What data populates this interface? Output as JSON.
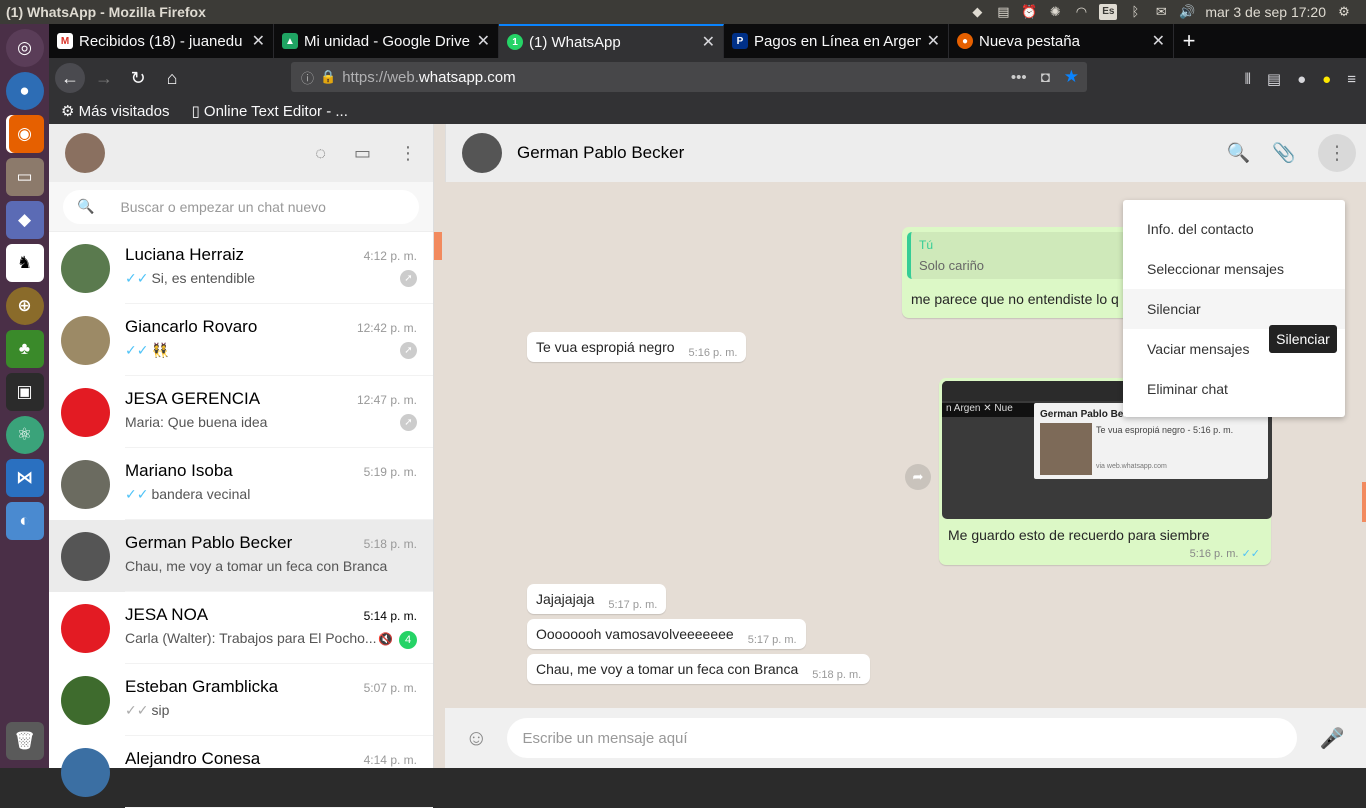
{
  "window": {
    "title": "(1) WhatsApp - Mozilla Firefox"
  },
  "tray": {
    "lang": "Es",
    "clock": "mar  3 de sep 17:20"
  },
  "tabs": [
    {
      "label": "Recibidos (18) - juanedu",
      "icon": "gmail-icon"
    },
    {
      "label": "Mi unidad - Google Drive",
      "icon": "drive-icon"
    },
    {
      "label": "(1) WhatsApp",
      "icon": "whatsapp-icon",
      "active": true
    },
    {
      "label": "Pagos en Línea en Argen",
      "icon": "paypal-icon"
    },
    {
      "label": "Nueva pestaña",
      "icon": "firefox-icon"
    }
  ],
  "url": {
    "prefix": "https://web.",
    "domain": "whatsapp.com"
  },
  "bookmarks": [
    "Más visitados",
    "Online Text Editor - ..."
  ],
  "sidebar": {
    "search_placeholder": "Buscar o empezar un chat nuevo",
    "chats": [
      {
        "name": "Luciana Herraiz",
        "time": "4:12 p. m.",
        "msg": "Si, es entendible",
        "tick": "✓✓",
        "pinned": true,
        "avatar_color": "#5a7a4e"
      },
      {
        "name": "Giancarlo Rovaro",
        "time": "12:42 p. m.",
        "msg": "👯",
        "tick": "✓✓",
        "pinned": true,
        "avatar_color": "#9c8a66"
      },
      {
        "name": "JESA GERENCIA",
        "time": "12:47 p. m.",
        "msg": "Maria: Que buena idea",
        "tick": "",
        "pinned": true,
        "avatar_color": "#e31b23"
      },
      {
        "name": "Mariano Isoba",
        "time": "5:19 p. m.",
        "msg": "bandera vecinal",
        "tick": "✓✓",
        "avatar_color": "#6b6b60"
      },
      {
        "name": "German Pablo Becker",
        "time": "5:18 p. m.",
        "msg": "Chau, me voy a tomar un feca con Branca",
        "tick": "",
        "selected": true,
        "avatar_color": "#555"
      },
      {
        "name": "JESA NOA",
        "time": "5:14 p. m.",
        "msg": "Carla (Walter): Trabajos para El Pocho...",
        "tick": "",
        "unread": "4",
        "muted": true,
        "avatar_color": "#e31b23"
      },
      {
        "name": "Esteban Gramblicka",
        "time": "5:07 p. m.",
        "msg": "sip",
        "tick": "✓✓",
        "tick_grey": true,
        "avatar_color": "#3e6b2d"
      },
      {
        "name": "Alejandro Conesa",
        "time": "4:14 p. m.",
        "msg": "",
        "tick": "",
        "avatar_color": "#3b6fa3"
      }
    ]
  },
  "conversation": {
    "contact": "German Pablo Becker",
    "quote": {
      "name": "Tú",
      "text": "Solo cariño",
      "reply": "me parece que no entendiste lo q"
    },
    "messages": [
      {
        "text": "Te vua espropiá negro",
        "time": "5:16 p. m."
      },
      {
        "text": "Me guardo esto de recuerdo para siembre",
        "time": "5:16 p. m."
      },
      {
        "text": "Jajajajaja",
        "time": "5:17 p. m."
      },
      {
        "text": "Oooooooh vamosavolveeeeeee",
        "time": "5:17 p. m."
      },
      {
        "text": "Chau, me voy a tomar un feca con Branca",
        "time": "5:18 p. m."
      }
    ],
    "shot": {
      "tab": "n Argen  ✕   Nue",
      "notif_title": "German Pablo Becker",
      "notif_body": "Te vua espropiá negro - 5:16 p. m.",
      "notif_via": "via web.whatsapp.com"
    },
    "composer_placeholder": "Escribe un mensaje aquí"
  },
  "menu": {
    "items": [
      "Info. del contacto",
      "Seleccionar mensajes",
      "Silenciar",
      "Vaciar mensajes",
      "Eliminar chat"
    ]
  },
  "tooltip": "Silenciar",
  "colors": {
    "accent": "#0a84ff",
    "wa_green": "#25d366",
    "bubble_out": "#dcf8c6",
    "tick_blue": "#4fc3f7"
  }
}
